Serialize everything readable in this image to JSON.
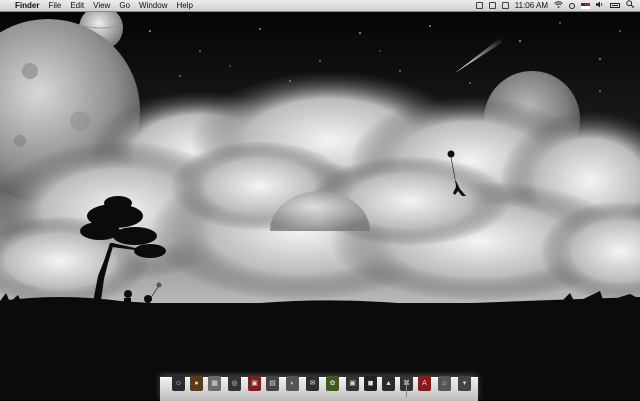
{
  "menubar": {
    "apple": "",
    "app_name": "Finder",
    "menus": [
      "File",
      "Edit",
      "View",
      "Go",
      "Window",
      "Help"
    ],
    "clock": "11:06 AM"
  },
  "dock": {
    "items": [
      {
        "name": "finder-icon",
        "color": "#2a2a2a",
        "glyph": "☺"
      },
      {
        "name": "app-icon-2",
        "color": "#5a3a1a",
        "glyph": "●"
      },
      {
        "name": "app-icon-3",
        "color": "#6a6a6a",
        "glyph": "▦"
      },
      {
        "name": "safari-icon",
        "color": "#333",
        "glyph": "◎"
      },
      {
        "name": "app-icon-5",
        "color": "#7a1f1f",
        "glyph": "▣"
      },
      {
        "name": "app-icon-6",
        "color": "#444",
        "glyph": "▤"
      },
      {
        "name": "app-icon-7",
        "color": "#555",
        "glyph": "◐"
      },
      {
        "name": "app-icon-8",
        "color": "#2f2f2f",
        "glyph": "✉"
      },
      {
        "name": "app-icon-9",
        "color": "#3e5a1e",
        "glyph": "✿"
      },
      {
        "name": "app-icon-10",
        "color": "#333",
        "glyph": "▣"
      },
      {
        "name": "app-icon-11",
        "color": "#222",
        "glyph": "◼"
      },
      {
        "name": "app-icon-12",
        "color": "#2a2a2a",
        "glyph": "▲"
      },
      {
        "name": "app-icon-13",
        "color": "#333",
        "glyph": "⌘"
      },
      {
        "name": "app-icon-14",
        "color": "#8a1a1a",
        "glyph": "A"
      },
      {
        "name": "home-folder-icon",
        "color": "#555",
        "glyph": "⌂"
      },
      {
        "name": "trash-icon",
        "color": "#444",
        "glyph": "▾"
      }
    ]
  }
}
